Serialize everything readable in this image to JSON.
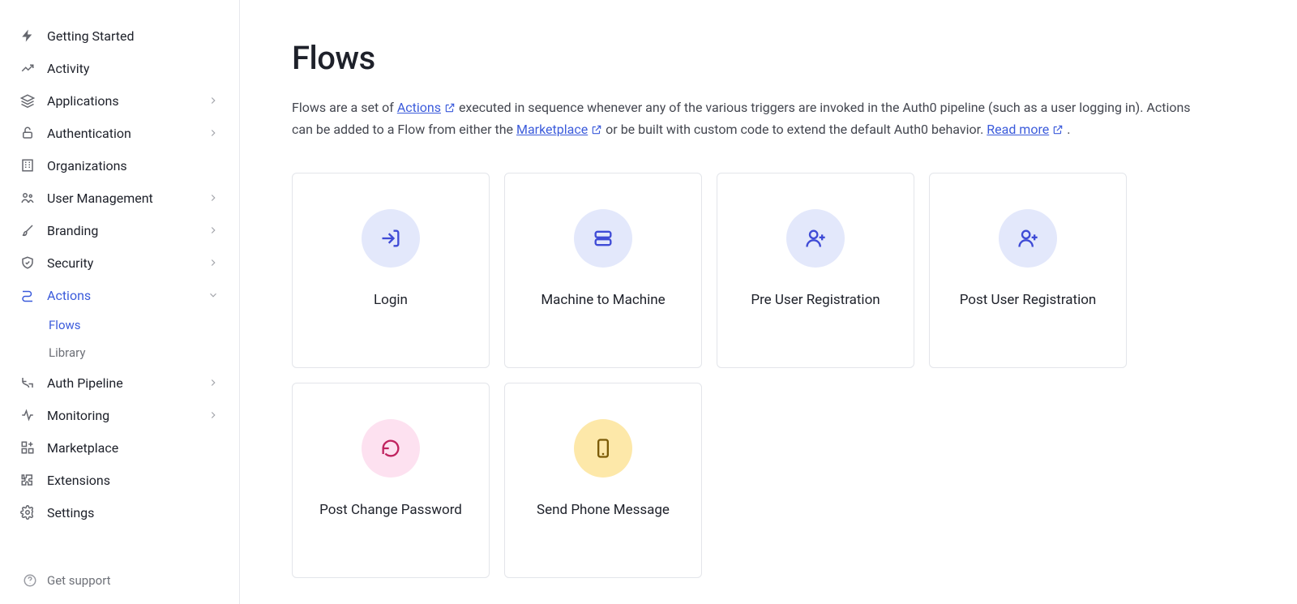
{
  "sidebar": {
    "items": [
      {
        "label": "Getting Started",
        "icon": "bolt",
        "expandable": false
      },
      {
        "label": "Activity",
        "icon": "chart-line",
        "expandable": false
      },
      {
        "label": "Applications",
        "icon": "stack",
        "expandable": true
      },
      {
        "label": "Authentication",
        "icon": "lock",
        "expandable": true
      },
      {
        "label": "Organizations",
        "icon": "building",
        "expandable": false
      },
      {
        "label": "User Management",
        "icon": "users",
        "expandable": true
      },
      {
        "label": "Branding",
        "icon": "brush",
        "expandable": true
      },
      {
        "label": "Security",
        "icon": "shield",
        "expandable": true
      },
      {
        "label": "Actions",
        "icon": "flow",
        "expandable": true,
        "active": true,
        "expanded": true,
        "sub": [
          {
            "label": "Flows",
            "active": true
          },
          {
            "label": "Library",
            "active": false
          }
        ]
      },
      {
        "label": "Auth Pipeline",
        "icon": "pipeline",
        "expandable": true
      },
      {
        "label": "Monitoring",
        "icon": "pulse",
        "expandable": true
      },
      {
        "label": "Marketplace",
        "icon": "grid-plus",
        "expandable": false
      },
      {
        "label": "Extensions",
        "icon": "puzzle",
        "expandable": false
      },
      {
        "label": "Settings",
        "icon": "gear",
        "expandable": false
      }
    ],
    "support_label": "Get support"
  },
  "page": {
    "title": "Flows",
    "desc_pre": "Flows are a set of ",
    "link_actions": "Actions",
    "desc_mid1": " executed in sequence whenever any of the various triggers are invoked in the Auth0 pipeline (such as a user logging in). Actions can be added to a Flow from either the ",
    "link_marketplace": "Marketplace",
    "desc_mid2": " or be built with custom code to extend the default Auth0 behavior. ",
    "link_readmore": "Read more",
    "desc_end": "."
  },
  "flows": [
    {
      "title": "Login",
      "icon": "login",
      "color": "blue"
    },
    {
      "title": "Machine to Machine",
      "icon": "server",
      "color": "blue"
    },
    {
      "title": "Pre User Registration",
      "icon": "user-plus",
      "color": "blue"
    },
    {
      "title": "Post User Registration",
      "icon": "user-plus",
      "color": "blue"
    },
    {
      "title": "Post Change Password",
      "icon": "rotate",
      "color": "pink"
    },
    {
      "title": "Send Phone Message",
      "icon": "phone",
      "color": "yellow"
    }
  ]
}
